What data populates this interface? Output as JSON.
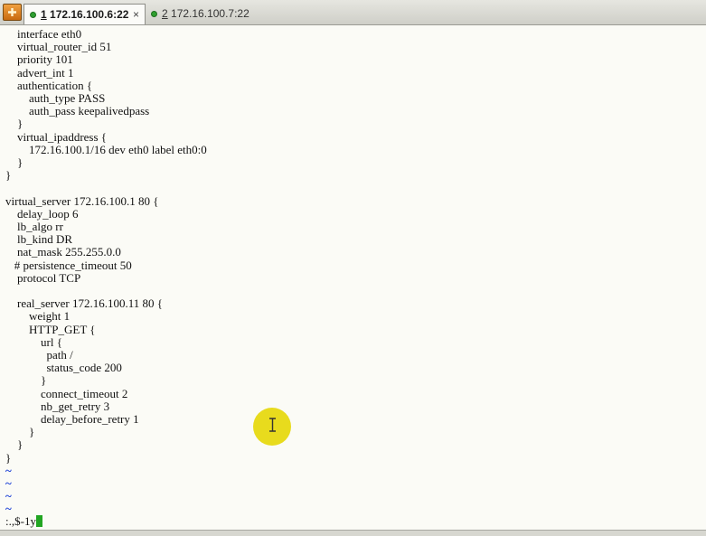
{
  "tabs": [
    {
      "number": "1",
      "title": "172.16.100.6:22",
      "active": true,
      "close": "×"
    },
    {
      "number": "2",
      "title": "172.16.100.7:22",
      "active": false
    }
  ],
  "terminal": {
    "lines": [
      "    interface eth0",
      "    virtual_router_id 51",
      "    priority 101",
      "    advert_int 1",
      "    authentication {",
      "        auth_type PASS",
      "        auth_pass keepalivedpass",
      "    }",
      "    virtual_ipaddress {",
      "        172.16.100.1/16 dev eth0 label eth0:0",
      "    }",
      "}",
      "",
      "virtual_server 172.16.100.1 80 {",
      "    delay_loop 6",
      "    lb_algo rr",
      "    lb_kind DR",
      "    nat_mask 255.255.0.0",
      "   # persistence_timeout 50",
      "    protocol TCP",
      "",
      "    real_server 172.16.100.11 80 {",
      "        weight 1",
      "        HTTP_GET {",
      "            url {",
      "              path /",
      "              status_code 200",
      "            }",
      "            connect_timeout 2",
      "            nb_get_retry 3",
      "            delay_before_retry 1",
      "        }",
      "    }",
      "}"
    ],
    "tildes": [
      "~",
      "~",
      "~",
      "~"
    ],
    "command": ":.,$-1y"
  },
  "colors": {
    "tilde": "#1a3fd6",
    "cursor": "#22a522",
    "pointer_highlight": "#e6d80a",
    "status_dot": "#2f9e2f"
  }
}
